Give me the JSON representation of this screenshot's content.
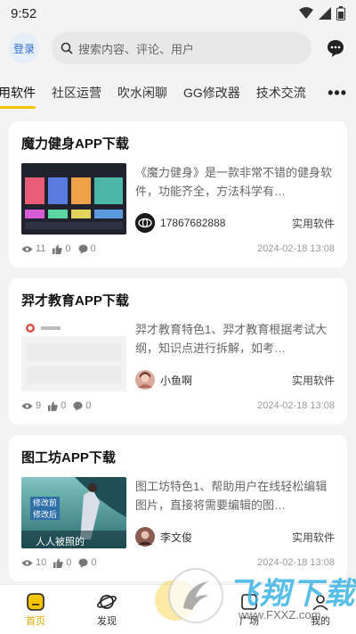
{
  "status": {
    "time": "9:52"
  },
  "header": {
    "login_label": "登录",
    "search_placeholder": "搜索内容、评论、用户"
  },
  "tabs": [
    {
      "label": "用软件"
    },
    {
      "label": "社区运营"
    },
    {
      "label": "吹水闲聊"
    },
    {
      "label": "GG修改器"
    },
    {
      "label": "技术交流"
    }
  ],
  "tabs_more": "•••",
  "posts": [
    {
      "title": "魔力健身APP下载",
      "desc": "《魔力健身》是一款非常不错的健身软件，功能齐全，方法科学有…",
      "author": "17867682888",
      "category": "实用软件",
      "views": "11",
      "likes": "0",
      "comments": "0",
      "date": "2024-02-18 13:08"
    },
    {
      "title": "羿才教育APP下载",
      "desc": "羿才教育特色1、羿才教育根据考试大纲，知识点进行拆解，如考…",
      "author": "小鱼啊",
      "category": "实用软件",
      "views": "9",
      "likes": "0",
      "comments": "0",
      "date": "2024-02-18 13:08"
    },
    {
      "title": "图工坊APP下载",
      "desc": "图工坊特色1、帮助用户在线轻松编辑图片，直接将需要编辑的图…",
      "author": "李文俊",
      "category": "实用软件",
      "views": "10",
      "likes": "0",
      "comments": "0",
      "date": "2024-02-18 13:08",
      "thumb_labels": [
        "修改前",
        "修改后",
        "人人被照的"
      ]
    }
  ],
  "bottom_nav": [
    {
      "label": "首页",
      "icon": "home-icon"
    },
    {
      "label": "发现",
      "icon": "planet-icon"
    },
    {
      "label": "广场",
      "icon": "square-icon"
    },
    {
      "label": "我的",
      "icon": "user-icon"
    }
  ],
  "watermark": {
    "text": "飞翔下载",
    "url_text": "www.FXXZ.com"
  },
  "colors": {
    "accent": "#f5c400",
    "login_blue": "#2f6fd1",
    "background": "#f3f3f3"
  }
}
